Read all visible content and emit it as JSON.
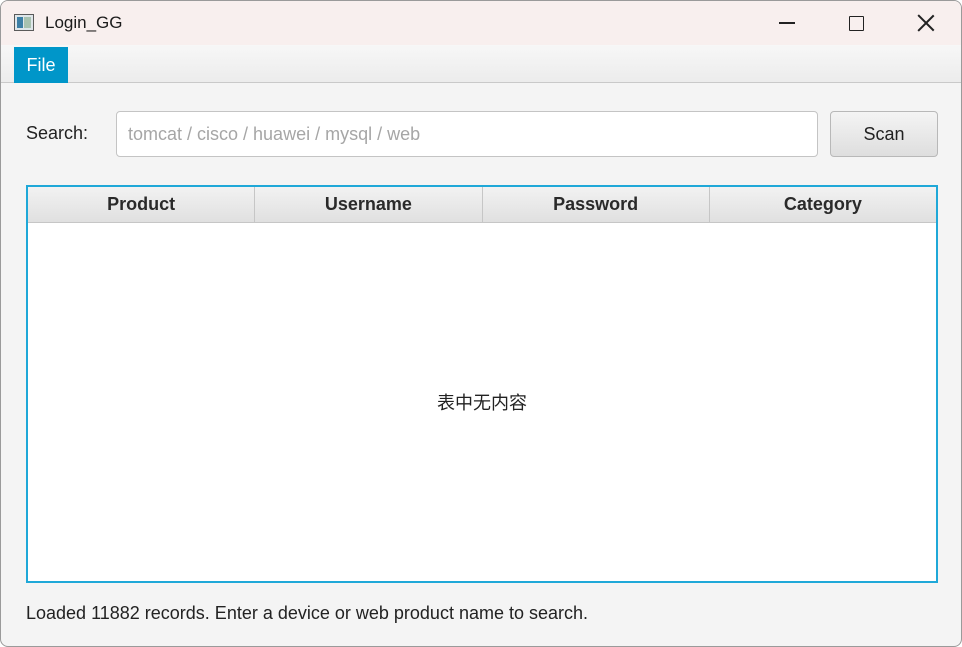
{
  "window": {
    "title": "Login_GG",
    "icon": "app-window-icon"
  },
  "menu": {
    "items": [
      {
        "label": "File",
        "active": true
      }
    ]
  },
  "search": {
    "label": "Search:",
    "value": "",
    "placeholder": "tomcat / cisco / huawei / mysql / web",
    "button_label": "Scan"
  },
  "table": {
    "columns": [
      "Product",
      "Username",
      "Password",
      "Category"
    ],
    "rows": [],
    "empty_text": "表中无内容"
  },
  "status": {
    "text": "Loaded 11882 records. Enter a device or web product name to search."
  },
  "colors": {
    "accent": "#0096c9",
    "table_focus_border": "#1fa8d8",
    "titlebar_bg": "#f8efee"
  }
}
